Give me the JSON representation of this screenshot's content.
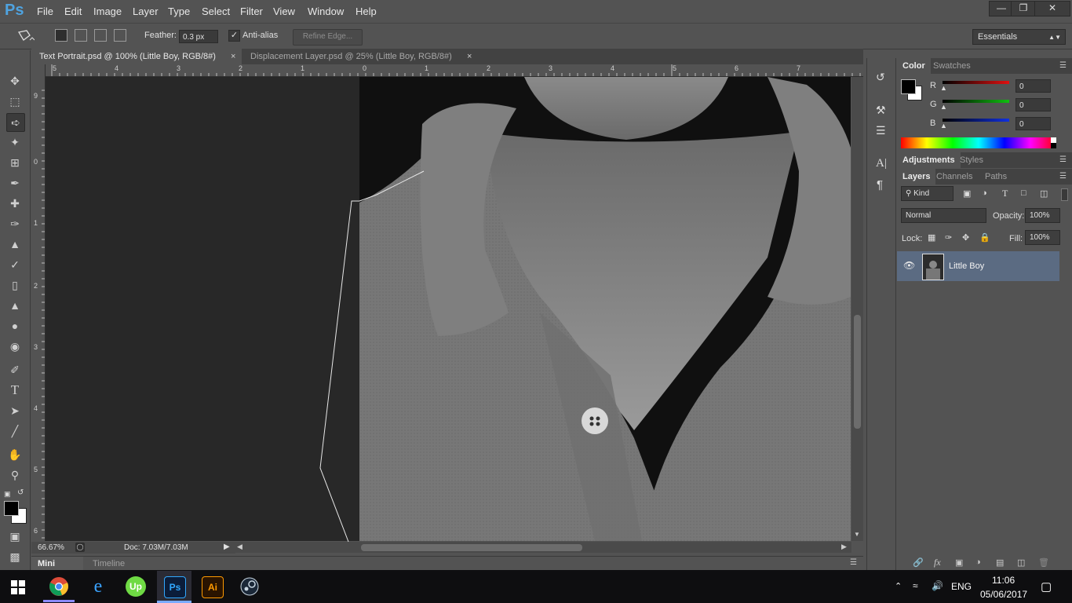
{
  "app": {
    "logo": "Ps",
    "menu": [
      "File",
      "Edit",
      "Image",
      "Layer",
      "Type",
      "Select",
      "Filter",
      "View",
      "Window",
      "Help"
    ]
  },
  "options_bar": {
    "feather_label": "Feather:",
    "feather_value": "0.3 px",
    "antialias_label": "Anti-alias",
    "antialias_checked": true,
    "refine_edge_label": "Refine Edge...",
    "workspace": "Essentials"
  },
  "documents": {
    "tabs": [
      {
        "label": "Text Portrait.psd @ 100% (Little Boy, RGB/8#)",
        "active": true
      },
      {
        "label": "Displacement Layer.psd @ 25% (Little Boy, RGB/8#)",
        "active": false
      }
    ],
    "close_glyph": "×"
  },
  "rulers": {
    "top": [
      "5",
      "4",
      "3",
      "2",
      "1",
      "0",
      "1",
      "2",
      "3",
      "4",
      "5",
      "6",
      "7"
    ],
    "left": [
      "9",
      "0",
      "1",
      "2",
      "3",
      "4",
      "5",
      "6"
    ]
  },
  "status": {
    "zoom": "66.67%",
    "doc_size": "Doc: 7.03M/7.03M"
  },
  "bottom_panel": {
    "tabs": [
      "Mini Bridge",
      "Timeline"
    ]
  },
  "color_panel": {
    "tabs": [
      "Color",
      "Swatches"
    ],
    "channels": [
      {
        "label": "R",
        "value": "0",
        "color": "#e01010"
      },
      {
        "label": "G",
        "value": "0",
        "color": "#10c010"
      },
      {
        "label": "B",
        "value": "0",
        "color": "#1030e0"
      }
    ]
  },
  "adjustments_panel": {
    "tabs": [
      "Adjustments",
      "Styles"
    ]
  },
  "layers_panel": {
    "tabs": [
      "Layers",
      "Channels",
      "Paths"
    ],
    "filter": "Kind",
    "blend_mode": "Normal",
    "opacity_label": "Opacity:",
    "opacity_value": "100%",
    "lock_label": "Lock:",
    "fill_label": "Fill:",
    "fill_value": "100%",
    "layers": [
      {
        "name": "Little Boy",
        "visible": true,
        "selected": true
      }
    ]
  },
  "taskbar": {
    "language": "ENG",
    "time": "11:06",
    "date": "05/06/2017",
    "apps": [
      "chrome",
      "edge",
      "upwork",
      "photoshop",
      "illustrator",
      "steam"
    ],
    "app_labels": {
      "upwork": "Up",
      "photoshop": "Ps",
      "illustrator": "Ai"
    }
  },
  "colors": {
    "accent_blue": "#4fa3e0",
    "layer_selected": "#5b6b82",
    "panel_bg": "#535353",
    "canvas_bg": "#282828"
  }
}
